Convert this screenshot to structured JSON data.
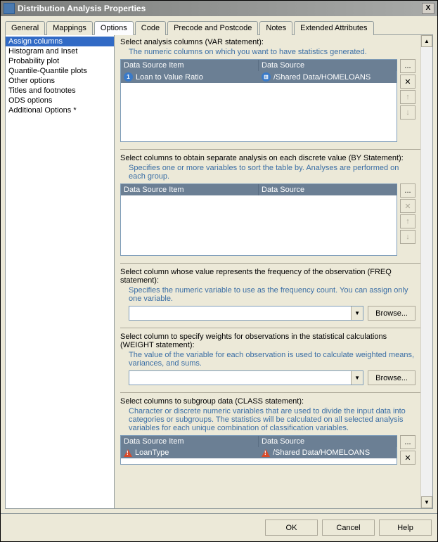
{
  "window": {
    "title": "Distribution Analysis Properties",
    "close": "X"
  },
  "tabs": [
    "General",
    "Mappings",
    "Options",
    "Code",
    "Precode and Postcode",
    "Notes",
    "Extended Attributes"
  ],
  "active_tab": "Options",
  "sidebar": {
    "items": [
      "Assign columns",
      "Histogram and Inset",
      "Probability plot",
      "Quantile-Quantile plots",
      "Other options",
      "Titles and footnotes",
      "ODS options",
      "Additional Options *"
    ],
    "selected": "Assign columns"
  },
  "sections": {
    "var": {
      "label": "Select analysis columns (VAR statement):",
      "desc": "The numeric columns on which you want to have statistics generated.",
      "headers": [
        "Data Source Item",
        "Data Source"
      ],
      "rows": [
        {
          "item": "Loan to Value Ratio",
          "source": "/Shared Data/HOMELOANS",
          "icon": "blue"
        }
      ]
    },
    "by": {
      "label": "Select columns to obtain separate analysis on each discrete value (BY Statement):",
      "desc": "Specifies one or more variables to sort the table by. Analyses are performed on each group.",
      "headers": [
        "Data Source Item",
        "Data Source"
      ],
      "rows": []
    },
    "freq": {
      "label": "Select column whose value represents the frequency of the observation (FREQ statement):",
      "desc": "Specifies the numeric variable to use as the frequency count. You can assign only one variable.",
      "value": "",
      "browse": "Browse..."
    },
    "weight": {
      "label": "Select column to specify weights for observations in the statistical calculations (WEIGHT statement):",
      "desc": "The value of the variable for each observation is used to calculate weighted means, variances, and sums.",
      "value": "",
      "browse": "Browse..."
    },
    "class": {
      "label": "Select columns to subgroup data (CLASS statement):",
      "desc": "Character or discrete numeric variables that are used to divide the input data into categories or subgroups. The statistics will be calculated on all selected analysis variables for each unique combination of classification variables.",
      "headers": [
        "Data Source Item",
        "Data Source"
      ],
      "rows": [
        {
          "item": "LoanType",
          "source": "/Shared Data/HOMELOANS",
          "icon": "tri"
        }
      ]
    }
  },
  "side_buttons": {
    "more": "...",
    "delete": "✕",
    "up": "↑",
    "down": "↓"
  },
  "footer": {
    "ok": "OK",
    "cancel": "Cancel",
    "help": "Help"
  }
}
